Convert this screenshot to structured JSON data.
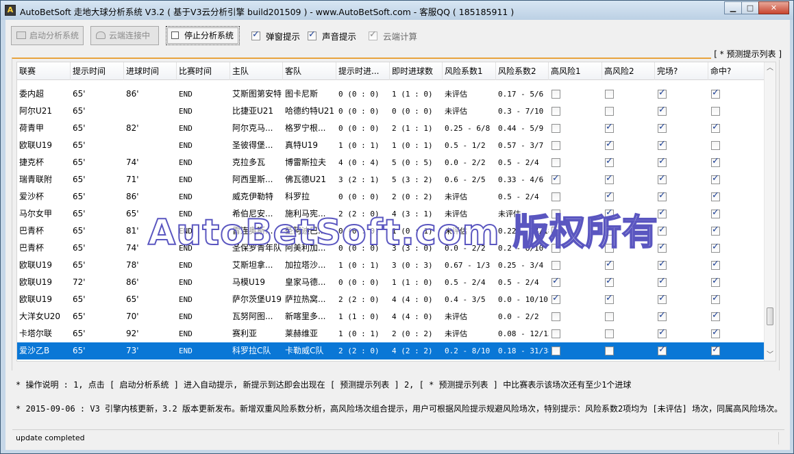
{
  "window": {
    "title": "AutoBetSoft 走地大球分析系统 V3.2 ( 基于V3云分析引擎 build201509 ) - www.AutoBetSoft.com - 客服QQ ( 185185911 )",
    "icon_letter": "A",
    "minimize": "▁",
    "maximize": "□",
    "close": "✕"
  },
  "toolbar": {
    "start_label": "启动分析系统",
    "cloud_label": "云端连接中",
    "stop_label": "停止分析系统",
    "popup_label": "弹窗提示",
    "sound_label": "声音提示",
    "cloud_calc_label": "云端计算",
    "popup_checked": true,
    "sound_checked": true,
    "cloud_calc_checked": true
  },
  "list_caption": "[ * 预测提示列表 ]",
  "columns": [
    "联赛",
    "提示时间",
    "进球时间",
    "比赛时间",
    "主队",
    "客队",
    "提示时进...",
    "即时进球数",
    "风险系数1",
    "风险系数2",
    "高风险1",
    "高风险2",
    "完场?",
    "命中?"
  ],
  "rows": [
    {
      "league": "委内超",
      "tip_time": "65'",
      "goal_time": "86'",
      "match_time": "END",
      "home": "艾斯图第安特",
      "away": "图卡尼斯",
      "tip_score": "0 (0 : 0)",
      "live_score": "1 (1 : 0)",
      "risk1": "未评估",
      "risk2": "0.17 - 5/6",
      "hr1": false,
      "hr2": false,
      "done": true,
      "hit": true
    },
    {
      "league": "阿尔U21",
      "tip_time": "65'",
      "goal_time": "",
      "match_time": "END",
      "home": "比捷亚U21",
      "away": "哈德约特U21",
      "tip_score": "0 (0 : 0)",
      "live_score": "0 (0 : 0)",
      "risk1": "未评估",
      "risk2": "0.3 - 7/10",
      "hr1": false,
      "hr2": false,
      "done": true,
      "hit": false
    },
    {
      "league": "荷青甲",
      "tip_time": "65'",
      "goal_time": "82'",
      "match_time": "END",
      "home": "阿尔克马...",
      "away": "格罗宁根...",
      "tip_score": "0 (0 : 0)",
      "live_score": "2 (1 : 1)",
      "risk1": "0.25 - 6/8",
      "risk2": "0.44 - 5/9",
      "hr1": false,
      "hr2": true,
      "done": true,
      "hit": true
    },
    {
      "league": "欧联U19",
      "tip_time": "65'",
      "goal_time": "",
      "match_time": "END",
      "home": "圣彼得堡...",
      "away": "真特U19",
      "tip_score": "1 (0 : 1)",
      "live_score": "1 (0 : 1)",
      "risk1": "0.5 - 1/2",
      "risk2": "0.57 - 3/7",
      "hr1": false,
      "hr2": true,
      "done": true,
      "hit": false
    },
    {
      "league": "捷克杯",
      "tip_time": "65'",
      "goal_time": "74'",
      "match_time": "END",
      "home": "克拉多瓦",
      "away": "博雷斯拉夫",
      "tip_score": "4 (0 : 4)",
      "live_score": "5 (0 : 5)",
      "risk1": "0.0 - 2/2",
      "risk2": "0.5 - 2/4",
      "hr1": false,
      "hr2": true,
      "done": true,
      "hit": true
    },
    {
      "league": "瑞青联附",
      "tip_time": "65'",
      "goal_time": "71'",
      "match_time": "END",
      "home": "阿西里斯...",
      "away": "佛瓦德U21",
      "tip_score": "3 (2 : 1)",
      "live_score": "5 (3 : 2)",
      "risk1": "0.6 - 2/5",
      "risk2": "0.33 - 4/6",
      "hr1": true,
      "hr2": true,
      "done": true,
      "hit": true
    },
    {
      "league": "爱沙杯",
      "tip_time": "65'",
      "goal_time": "86'",
      "match_time": "END",
      "home": "威克伊勒特",
      "away": "科罗拉",
      "tip_score": "0 (0 : 0)",
      "live_score": "2 (0 : 2)",
      "risk1": "未评估",
      "risk2": "0.5 - 2/4",
      "hr1": false,
      "hr2": true,
      "done": true,
      "hit": true
    },
    {
      "league": "马尔女甲",
      "tip_time": "65'",
      "goal_time": "65'",
      "match_time": "END",
      "home": "希伯尼安...",
      "away": "施利马宪...",
      "tip_score": "2 (2 : 0)",
      "live_score": "4 (3 : 1)",
      "risk1": "未评估",
      "risk2": "未评估",
      "hr1": false,
      "hr2": true,
      "done": true,
      "hit": true
    },
    {
      "league": "巴青杯",
      "tip_time": "65'",
      "goal_time": "81'",
      "match_time": "END",
      "home": "雷连奥斯...",
      "away": "圣阿迪巴...",
      "tip_score": "0 (0 : 0)",
      "live_score": "1 (0 : 1)",
      "risk1": "未评估",
      "risk2": "0.22 - 14/18",
      "hr1": false,
      "hr2": true,
      "done": true,
      "hit": true
    },
    {
      "league": "巴青杯",
      "tip_time": "65'",
      "goal_time": "74'",
      "match_time": "END",
      "home": "圣保罗青年队",
      "away": "阿美利加...",
      "tip_score": "0 (0 : 0)",
      "live_score": "3 (3 : 0)",
      "risk1": "0.0 - 2/2",
      "risk2": "0.2 - 8/10",
      "hr1": false,
      "hr2": false,
      "done": true,
      "hit": true
    },
    {
      "league": "欧联U19",
      "tip_time": "65'",
      "goal_time": "78'",
      "match_time": "END",
      "home": "艾斯坦拿...",
      "away": "加拉塔沙...",
      "tip_score": "1 (0 : 1)",
      "live_score": "3 (0 : 3)",
      "risk1": "0.67 - 1/3",
      "risk2": "0.25 - 3/4",
      "hr1": false,
      "hr2": true,
      "done": true,
      "hit": true
    },
    {
      "league": "欧联U19",
      "tip_time": "72'",
      "goal_time": "86'",
      "match_time": "END",
      "home": "马模U19",
      "away": "皇家马德...",
      "tip_score": "0 (0 : 0)",
      "live_score": "1 (1 : 0)",
      "risk1": "0.5 - 2/4",
      "risk2": "0.5 - 2/4",
      "hr1": true,
      "hr2": true,
      "done": true,
      "hit": true
    },
    {
      "league": "欧联U19",
      "tip_time": "65'",
      "goal_time": "65'",
      "match_time": "END",
      "home": "萨尔茨堡U19",
      "away": "萨拉热窝...",
      "tip_score": "2 (2 : 0)",
      "live_score": "4 (4 : 0)",
      "risk1": "0.4 - 3/5",
      "risk2": "0.0 - 10/10",
      "hr1": true,
      "hr2": true,
      "done": true,
      "hit": true
    },
    {
      "league": "大洋女U20",
      "tip_time": "65'",
      "goal_time": "70'",
      "match_time": "END",
      "home": "瓦努阿图...",
      "away": "新喀里多...",
      "tip_score": "1 (1 : 0)",
      "live_score": "4 (4 : 0)",
      "risk1": "未评估",
      "risk2": "0.0 - 2/2",
      "hr1": false,
      "hr2": false,
      "done": true,
      "hit": true
    },
    {
      "league": "卡塔尔联",
      "tip_time": "65'",
      "goal_time": "92'",
      "match_time": "END",
      "home": "赛利亚",
      "away": "莱赫维亚",
      "tip_score": "1 (0 : 1)",
      "live_score": "2 (0 : 2)",
      "risk1": "未评估",
      "risk2": "0.08 - 12/13",
      "hr1": false,
      "hr2": false,
      "done": true,
      "hit": true
    },
    {
      "league": "爱沙乙B",
      "tip_time": "65'",
      "goal_time": "73'",
      "match_time": "END",
      "home": "科罗拉C队",
      "away": "卡勒威C队",
      "tip_score": "2 (2 : 0)",
      "live_score": "4 (2 : 2)",
      "risk1": "0.2 - 8/10",
      "risk2": "0.18 - 31/38",
      "hr1": false,
      "hr2": false,
      "done": true,
      "hit": true
    }
  ],
  "selected_row": 15,
  "notes": {
    "operation": "* 操作说明 : 1, 点击 [ 启动分析系统 ] 进入自动提示, 新提示到达即会出现在 [ 预测提示列表 ] 2, [ * 预测提示列表 ] 中比赛表示该场次还有至少1个进球",
    "update": "* 2015-09-06 : V3 引擎内核更新，3.2 版本更新发布。新增双重风险系数分析，高风险场次组合提示，用户可根据风险提示规避风险场次，特别提示：风险系数2项均为 [未评估] 场次，同属高风险场次。"
  },
  "status_text": "update completed",
  "watermark": "AutoBetSoft.com 版权所有",
  "colors": {
    "selection": "#0a77d6",
    "title_bar": "#c6d7e8",
    "caption_border": "#e8a33c",
    "check": "#1c3f95"
  }
}
